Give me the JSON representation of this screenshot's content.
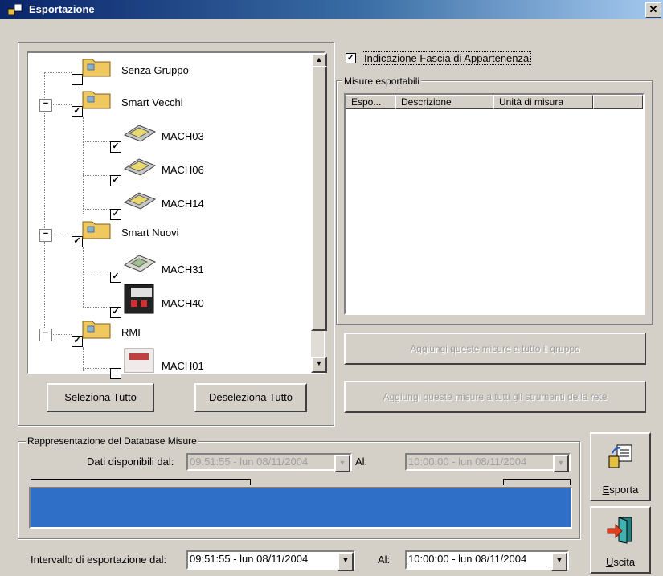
{
  "window": {
    "title": "Esportazione",
    "close_glyph": "✕"
  },
  "tree": {
    "groups": [
      {
        "label": "Senza Gruppo",
        "checked": false
      },
      {
        "label": "Smart Vecchi",
        "checked": true,
        "expander": "−",
        "devices": [
          "MACH03",
          "MACH06",
          "MACH14"
        ]
      },
      {
        "label": "Smart Nuovi",
        "checked": true,
        "expander": "−",
        "devices": [
          "MACH31",
          "MACH40"
        ]
      },
      {
        "label": "RMI",
        "checked": true,
        "expander": "−",
        "devices": [
          "MACH01"
        ]
      }
    ],
    "check_glyph": "✓",
    "scroll_up_glyph": "▲",
    "scroll_down_glyph": "▼"
  },
  "buttons": {
    "select_all_u": "S",
    "select_all_rest": "eleziona Tutto",
    "deselect_all_u": "D",
    "deselect_all_rest": "eseleziona Tutto",
    "add_group": "Aggiungi queste misure a tutto il gruppo",
    "add_network": "Aggiungi queste misure a tutti gli strumenti della rete",
    "export_u": "E",
    "export_rest": "sporta",
    "exit_u": "U",
    "exit_rest": "scita"
  },
  "options": {
    "band_indication": "Indicazione Fascia di Appartenenza",
    "band_checked": true
  },
  "measures": {
    "group_title": "Misure esportabili",
    "columns": [
      "Espo...",
      "Descrizione",
      "Unità di misura"
    ]
  },
  "database": {
    "group_title": "Rappresentazione del Database Misure",
    "available_from_label": "Dati disponibili  dal:",
    "available_from": "09:51:55 -  lun  08/11/2004",
    "to_label": "Al:",
    "available_to": "10:00:00 -  lun  08/11/2004",
    "bar_color": "#2f6fc8"
  },
  "export_interval": {
    "from_label": "Intervallo di esportazione  dal:",
    "from": "09:51:55 -  lun  08/11/2004",
    "to_label": "Al:",
    "to": "10:00:00 -  lun  08/11/2004"
  },
  "icons": {
    "window": "export-window-icon",
    "folder": "folder-icon",
    "device": "device-icon",
    "export": "export-icon",
    "exit": "exit-door-icon"
  }
}
